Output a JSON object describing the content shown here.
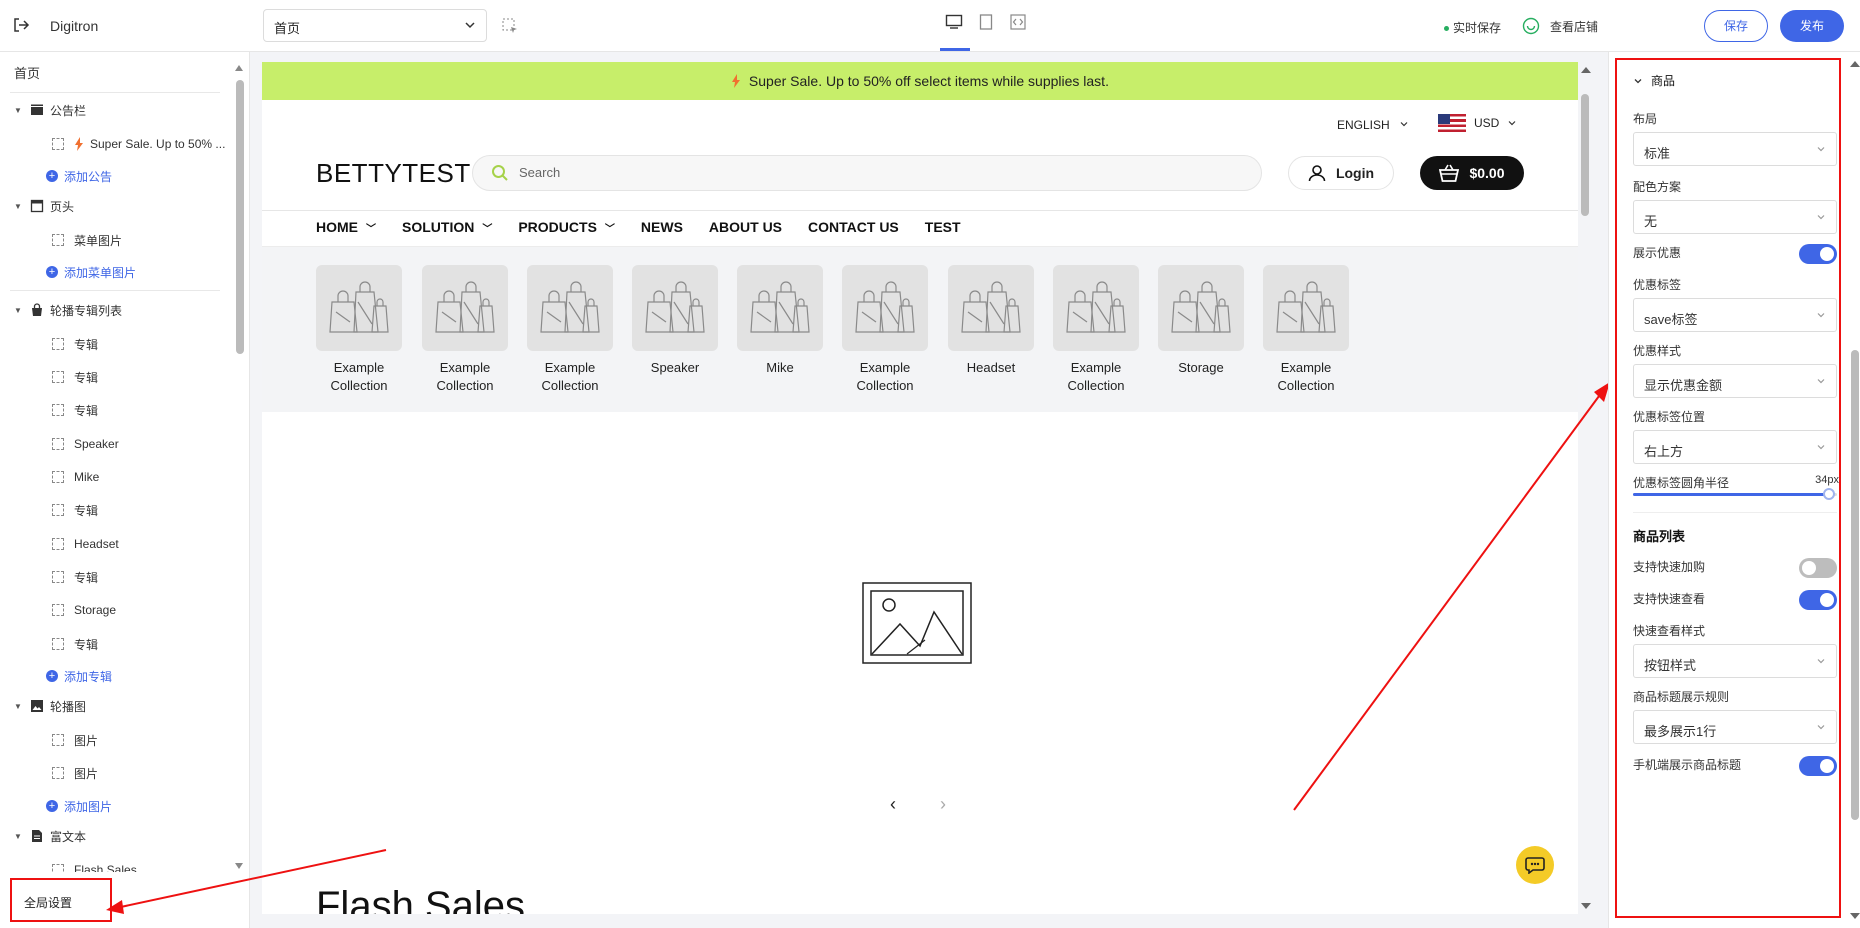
{
  "topbar": {
    "app_name": "Digitron",
    "page_select": "首页",
    "autosave": "实时保存",
    "view_store": "查看店铺",
    "save_label": "保存",
    "publish_label": "发布"
  },
  "sidebar": {
    "home": "首页",
    "sections": [
      {
        "label": "公告栏",
        "children": [
          "Super Sale. Up to 50% ..."
        ],
        "add": "添加公告"
      },
      {
        "label": "页头",
        "children": [
          "菜单图片"
        ],
        "add": "添加菜单图片"
      },
      {
        "label": "轮播专辑列表",
        "children": [
          "专辑",
          "专辑",
          "专辑",
          "Speaker",
          "Mike",
          "专辑",
          "Headset",
          "专辑",
          "Storage",
          "专辑"
        ],
        "add": "添加专辑"
      },
      {
        "label": "轮播图",
        "children": [
          "图片",
          "图片"
        ],
        "add": "添加图片"
      },
      {
        "label": "富文本",
        "children": [
          "Flash Sales"
        ]
      }
    ],
    "global_settings": "全局设置"
  },
  "preview": {
    "announcement": "Super Sale. Up to 50% off select items while supplies last.",
    "language": "ENGLISH",
    "currency": "USD",
    "logo": "BETTYTEST",
    "search_placeholder": "Search",
    "login": "Login",
    "cart_total": "$0.00",
    "nav": [
      "HOME",
      "SOLUTION",
      "PRODUCTS",
      "NEWS",
      "ABOUT US",
      "CONTACT US",
      "TEST"
    ],
    "collections": [
      {
        "line1": "Example",
        "line2": "Collection"
      },
      {
        "line1": "Example",
        "line2": "Collection"
      },
      {
        "line1": "Example",
        "line2": "Collection"
      },
      {
        "line1": "Speaker",
        "line2": ""
      },
      {
        "line1": "Mike",
        "line2": ""
      },
      {
        "line1": "Example",
        "line2": "Collection"
      },
      {
        "line1": "Headset",
        "line2": ""
      },
      {
        "line1": "Example",
        "line2": "Collection"
      },
      {
        "line1": "Storage",
        "line2": ""
      },
      {
        "line1": "Example",
        "line2": "Collection"
      }
    ],
    "flash_title": "Flash Sales"
  },
  "settings": {
    "section_title": "商品",
    "layout_label": "布局",
    "layout_value": "标准",
    "color_label": "配色方案",
    "color_value": "无",
    "show_discount_label": "展示优惠",
    "show_discount_on": true,
    "discount_tag_label": "优惠标签",
    "discount_tag_value": "save标签",
    "discount_style_label": "优惠样式",
    "discount_style_value": "显示优惠金额",
    "tag_position_label": "优惠标签位置",
    "tag_position_value": "右上方",
    "radius_label": "优惠标签圆角半径",
    "radius_value": "34px",
    "radius_fraction": 0.96,
    "product_list_title": "商品列表",
    "quick_add_label": "支持快速加购",
    "quick_add_on": false,
    "quick_view_label": "支持快速查看",
    "quick_view_on": true,
    "quick_view_style_label": "快速查看样式",
    "quick_view_style_value": "按钮样式",
    "title_rule_label": "商品标题展示规则",
    "title_rule_value": "最多展示1行",
    "mobile_title_label": "手机端展示商品标题",
    "mobile_title_on": true
  },
  "colors": {
    "accent": "#3f66e6",
    "announcement_bg": "#c7ee6a",
    "annotation_red": "#e11"
  }
}
